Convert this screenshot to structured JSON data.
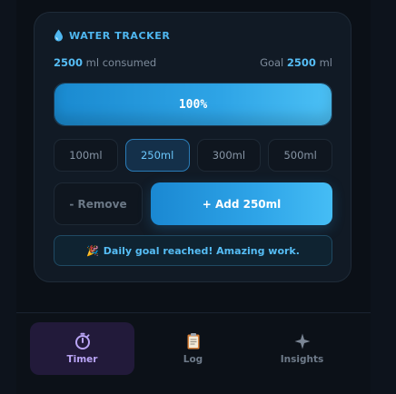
{
  "card": {
    "title": "WATER TRACKER",
    "consumed_value": "2500",
    "consumed_suffix": "ml consumed",
    "goal_prefix": "Goal",
    "goal_value": "2500",
    "goal_unit": "ml",
    "progress": {
      "percent_label": "100%",
      "fraction": 1.0
    },
    "amount_options": [
      {
        "label": "100ml",
        "selected": false
      },
      {
        "label": "250ml",
        "selected": true
      },
      {
        "label": "300ml",
        "selected": false
      },
      {
        "label": "500ml",
        "selected": false
      }
    ],
    "remove_label": "- Remove",
    "add_label": "+ Add 250ml",
    "goal_message_emoji": "🎉",
    "goal_message": "Daily goal reached! Amazing work."
  },
  "nav": {
    "items": [
      {
        "label": "Timer",
        "icon": "stopwatch-icon",
        "active": true
      },
      {
        "label": "Log",
        "icon": "clipboard-icon",
        "active": false
      },
      {
        "label": "Insights",
        "icon": "sparkle-icon",
        "active": false
      }
    ]
  },
  "colors": {
    "accent": "#4fb7f0",
    "active_nav": "#b9a4f5",
    "background": "#0b1017"
  }
}
